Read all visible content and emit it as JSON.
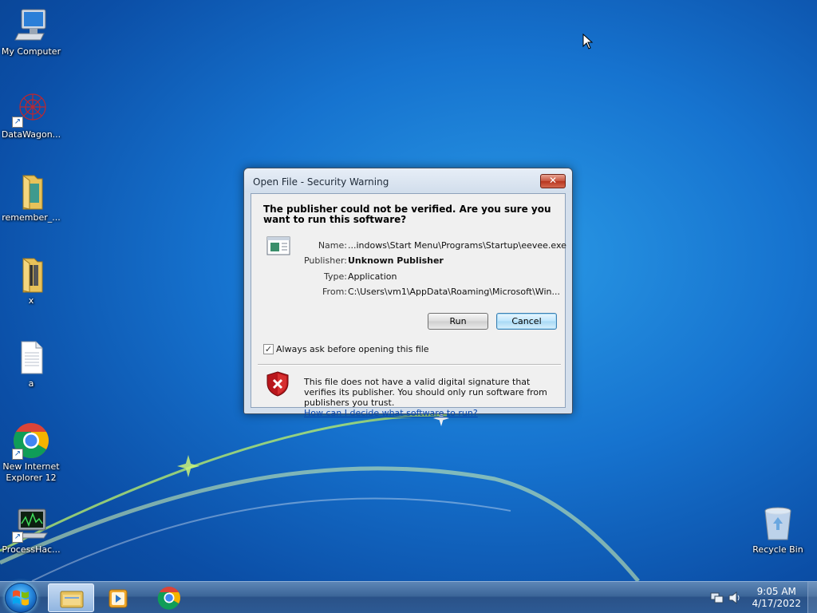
{
  "desktop": {
    "icons": [
      {
        "label": "My Computer"
      },
      {
        "label": "DataWagon..."
      },
      {
        "label": "remember_..."
      },
      {
        "label": "x"
      },
      {
        "label": "a"
      },
      {
        "label_line1": "New Internet",
        "label_line2": "Explorer 12"
      },
      {
        "label": "ProcessHac..."
      },
      {
        "label": "Recycle Bin"
      }
    ]
  },
  "dialog": {
    "title": "Open File - Security Warning",
    "close_label": "✕",
    "headline": "The publisher could not be verified.  Are you sure you want to run this software?",
    "fields": {
      "name_label": "Name:",
      "name_value": "...indows\\Start Menu\\Programs\\Startup\\eevee.exe",
      "publisher_label": "Publisher:",
      "publisher_value": "Unknown Publisher",
      "type_label": "Type:",
      "type_value": "Application",
      "from_label": "From:",
      "from_value": "C:\\Users\\vm1\\AppData\\Roaming\\Microsoft\\Win..."
    },
    "run_label": "Run",
    "cancel_label": "Cancel",
    "checkbox_label": "Always ask before opening this file",
    "checkbox_checked": true,
    "warning_text": "This file does not have a valid digital signature that verifies its publisher.  You should only run software from publishers you trust.",
    "warning_link": "How can I decide what software to run?"
  },
  "taskbar": {
    "time": "9:05 AM",
    "date": "4/17/2022",
    "items": [
      "windows-explorer-icon",
      "media-player-icon",
      "chrome-icon"
    ]
  }
}
